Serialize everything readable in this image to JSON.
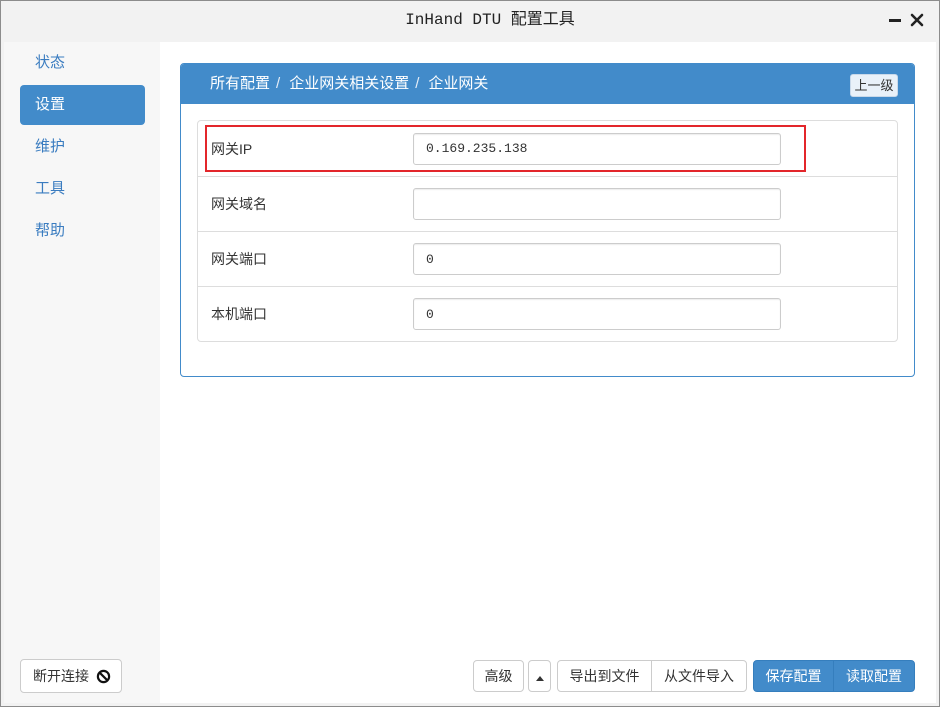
{
  "window": {
    "title": "InHand DTU 配置工具"
  },
  "sidebar": {
    "items": [
      {
        "label": "状态",
        "active": false
      },
      {
        "label": "设置",
        "active": true
      },
      {
        "label": "维护",
        "active": false
      },
      {
        "label": "工具",
        "active": false
      },
      {
        "label": "帮助",
        "active": false
      }
    ],
    "disconnect_label": "断开连接"
  },
  "panel": {
    "breadcrumb": [
      "所有配置",
      "企业网关相关设置",
      "企业网关"
    ],
    "separator": "/",
    "back_label": "上一级"
  },
  "fields": [
    {
      "label": "网关IP",
      "value": "0.169.235.138",
      "highlighted": true
    },
    {
      "label": "网关域名",
      "value": ""
    },
    {
      "label": "网关端口",
      "value": "0"
    },
    {
      "label": "本机端口",
      "value": "0"
    }
  ],
  "toolbar": {
    "advanced_label": "高级",
    "export_label": "导出到文件",
    "import_label": "从文件导入",
    "save_label": "保存配置",
    "read_label": "读取配置"
  },
  "icons": {
    "minimize": "minimize-icon",
    "close": "close-icon",
    "advanced_dropdown": "caret-up-icon",
    "disconnect": "ban-icon"
  },
  "colors": {
    "accent": "#428bca",
    "accent_border": "#357ebd",
    "nav_link": "#3a7cc0",
    "highlight": "#e3262b"
  }
}
